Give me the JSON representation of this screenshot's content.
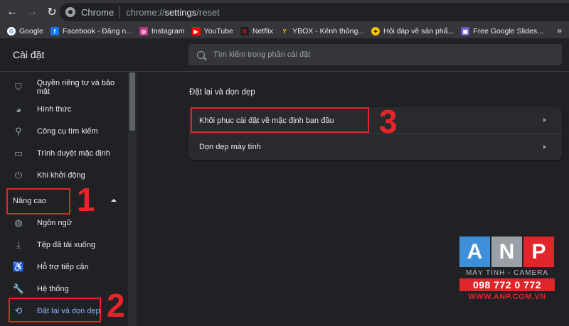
{
  "browser": {
    "site_label": "Chrome",
    "url_scheme": "chrome://",
    "url_host": "settings",
    "url_path": "/reset",
    "nav": {
      "back_icon": "arrow-left-icon",
      "forward_icon": "arrow-right-icon",
      "reload_icon": "reload-icon"
    }
  },
  "bookmarks": [
    {
      "label": "Google",
      "icon": "google-icon",
      "color": "#ffffff",
      "glyph": "G"
    },
    {
      "label": "Facebook - Đăng n...",
      "icon": "facebook-icon",
      "color": "#1877f2",
      "glyph": "f"
    },
    {
      "label": "Instagram",
      "icon": "instagram-icon",
      "color": "#c13584",
      "glyph": "◎"
    },
    {
      "label": "YouTube",
      "icon": "youtube-icon",
      "color": "#ff0000",
      "glyph": "▶"
    },
    {
      "label": "Netflix",
      "icon": "netflix-icon",
      "color": "#202124",
      "glyph": "N"
    },
    {
      "label": "YBOX - Kênh thông...",
      "icon": "ybox-icon",
      "color": "#35363a",
      "glyph": "Y"
    },
    {
      "label": "Hỏi đáp về sản phẩ...",
      "icon": "help-icon",
      "color": "#f4c20d",
      "glyph": "✦"
    },
    {
      "label": "Free Google Slides...",
      "icon": "slides-icon",
      "color": "#6a5acd",
      "glyph": "▣"
    }
  ],
  "bookmarks_more": "»",
  "header": {
    "title": "Cài đặt",
    "search_placeholder": "Tìm kiếm trong phần cài đặt"
  },
  "sidebar": {
    "items": [
      {
        "label": "Quyền riêng tư và bảo mật",
        "icon": "shield-icon",
        "glyph": "⛉"
      },
      {
        "label": "Hình thức",
        "icon": "palette-icon",
        "glyph": "◕"
      },
      {
        "label": "Công cụ tìm kiếm",
        "icon": "search-icon",
        "glyph": "⚲"
      },
      {
        "label": "Trình duyệt mặc định",
        "icon": "browser-icon",
        "glyph": "▭"
      },
      {
        "label": "Khi khởi động",
        "icon": "power-icon",
        "glyph": "⏻"
      }
    ],
    "advanced_label": "Nâng cao",
    "advanced_items": [
      {
        "label": "Ngôn ngữ",
        "icon": "globe-icon",
        "glyph": "◍"
      },
      {
        "label": "Tệp đã tải xuống",
        "icon": "download-icon",
        "glyph": "⤓"
      },
      {
        "label": "Hỗ trợ tiếp cận",
        "icon": "accessibility-icon",
        "glyph": "♿"
      },
      {
        "label": "Hệ thống",
        "icon": "wrench-icon",
        "glyph": "🔧"
      },
      {
        "label": "Đặt lại và dọn dẹp",
        "icon": "restore-icon",
        "glyph": "⟲",
        "active": true
      }
    ]
  },
  "main": {
    "section_title": "Đặt lại và dọn dẹp",
    "rows": [
      {
        "label": "Khôi phục cài đặt về mặc định ban đầu"
      },
      {
        "label": "Dọn dẹp máy tính"
      }
    ]
  },
  "annotations": {
    "step1": "1",
    "step2": "2",
    "step3": "3",
    "color": "#e8242a"
  },
  "watermark": {
    "letters": [
      "A",
      "N",
      "P"
    ],
    "subtitle": "MÁY TÍNH - CAMERA",
    "phone": "098 772 0 772",
    "website": "WWW.ANP.COM.VN"
  }
}
